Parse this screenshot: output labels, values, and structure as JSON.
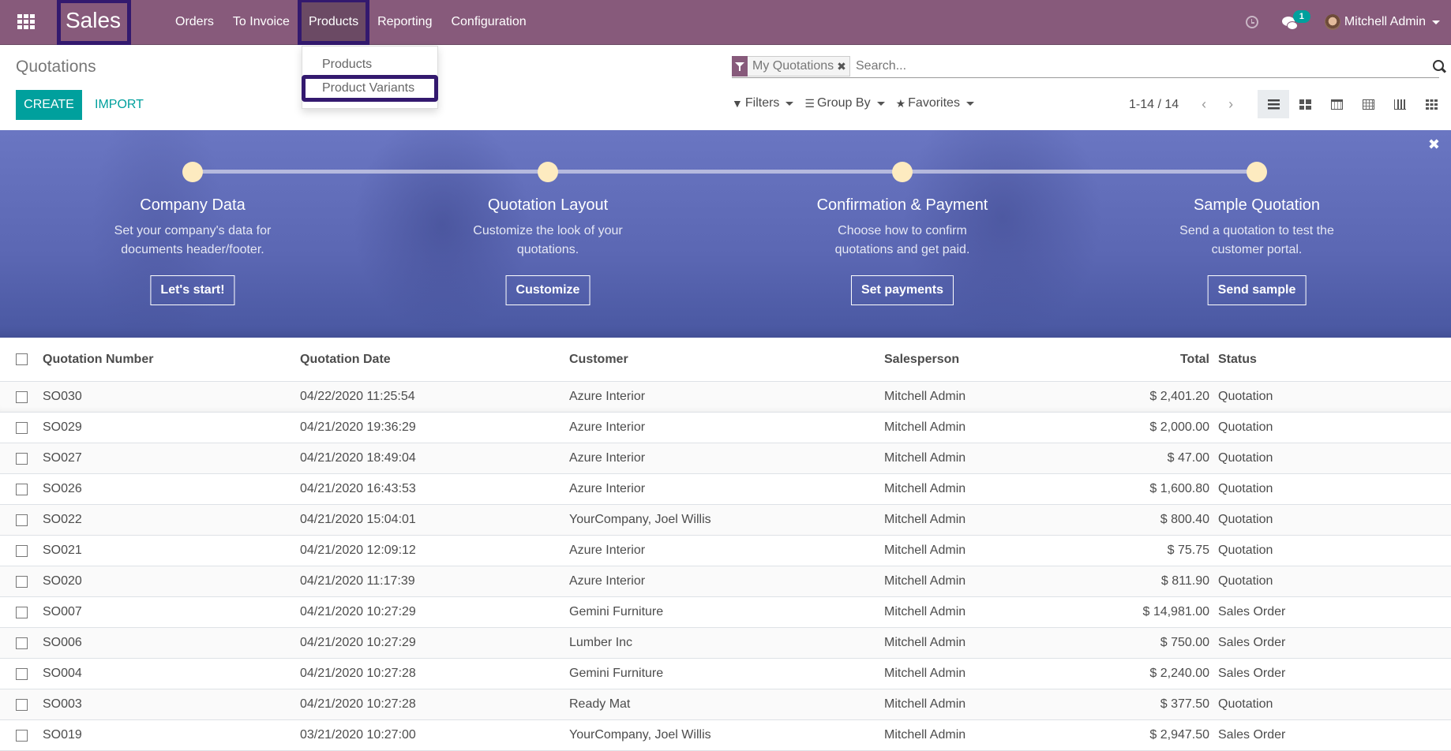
{
  "navbar": {
    "apps_icon": "grid-icon",
    "brand": "Sales",
    "menu": [
      {
        "label": "Orders"
      },
      {
        "label": "To Invoice"
      },
      {
        "label": "Products",
        "active": true
      },
      {
        "label": "Reporting"
      },
      {
        "label": "Configuration"
      }
    ],
    "activity_icon": "clock-icon",
    "messages_icon": "chat-icon",
    "messages_count": "1",
    "user_name": "Mitchell Admin"
  },
  "products_dropdown": {
    "items": [
      {
        "label": "Products"
      },
      {
        "label": "Product Variants",
        "highlighted": true
      }
    ]
  },
  "control_panel": {
    "title": "Quotations",
    "create_label": "CREATE",
    "import_label": "IMPORT",
    "search": {
      "facet_label": "My Quotations",
      "facet_close": "✖",
      "placeholder": "Search..."
    },
    "filters_label": "Filters",
    "groupby_label": "Group By",
    "favorites_label": "Favorites",
    "pager": "1-14 / 14",
    "pager_prev": "‹",
    "pager_next": "›",
    "views": [
      "list",
      "kanban",
      "calendar",
      "pivot",
      "graph",
      "activity"
    ],
    "active_view": "list"
  },
  "colors": {
    "brand": "#875a7b",
    "accent": "#00a09d",
    "highlight_border": "#33196e",
    "banner": "#5b67b3",
    "step_dot": "#fdebc0"
  },
  "onboarding": {
    "close": "✖",
    "steps": [
      {
        "title": "Company Data",
        "desc": "Set your company's data for documents header/footer.",
        "button": "Let's start!"
      },
      {
        "title": "Quotation Layout",
        "desc": "Customize the look of your quotations.",
        "button": "Customize"
      },
      {
        "title": "Confirmation & Payment",
        "desc": "Choose how to confirm quotations and get paid.",
        "button": "Set payments"
      },
      {
        "title": "Sample Quotation",
        "desc": "Send a quotation to test the customer portal.",
        "button": "Send sample"
      }
    ]
  },
  "table": {
    "columns": [
      "Quotation Number",
      "Quotation Date",
      "Customer",
      "Salesperson",
      "Total",
      "Status"
    ],
    "rows": [
      {
        "number": "SO030",
        "date": "04/22/2020 11:25:54",
        "customer": "Azure Interior",
        "salesperson": "Mitchell Admin",
        "total": "$ 2,401.20",
        "status": "Quotation"
      },
      {
        "number": "SO029",
        "date": "04/21/2020 19:36:29",
        "customer": "Azure Interior",
        "salesperson": "Mitchell Admin",
        "total": "$ 2,000.00",
        "status": "Quotation"
      },
      {
        "number": "SO027",
        "date": "04/21/2020 18:49:04",
        "customer": "Azure Interior",
        "salesperson": "Mitchell Admin",
        "total": "$ 47.00",
        "status": "Quotation"
      },
      {
        "number": "SO026",
        "date": "04/21/2020 16:43:53",
        "customer": "Azure Interior",
        "salesperson": "Mitchell Admin",
        "total": "$ 1,600.80",
        "status": "Quotation"
      },
      {
        "number": "SO022",
        "date": "04/21/2020 15:04:01",
        "customer": "YourCompany, Joel Willis",
        "salesperson": "Mitchell Admin",
        "total": "$ 800.40",
        "status": "Quotation"
      },
      {
        "number": "SO021",
        "date": "04/21/2020 12:09:12",
        "customer": "Azure Interior",
        "salesperson": "Mitchell Admin",
        "total": "$ 75.75",
        "status": "Quotation"
      },
      {
        "number": "SO020",
        "date": "04/21/2020 11:17:39",
        "customer": "Azure Interior",
        "salesperson": "Mitchell Admin",
        "total": "$ 811.90",
        "status": "Quotation"
      },
      {
        "number": "SO007",
        "date": "04/21/2020 10:27:29",
        "customer": "Gemini Furniture",
        "salesperson": "Mitchell Admin",
        "total": "$ 14,981.00",
        "status": "Sales Order"
      },
      {
        "number": "SO006",
        "date": "04/21/2020 10:27:29",
        "customer": "Lumber Inc",
        "salesperson": "Mitchell Admin",
        "total": "$ 750.00",
        "status": "Sales Order"
      },
      {
        "number": "SO004",
        "date": "04/21/2020 10:27:28",
        "customer": "Gemini Furniture",
        "salesperson": "Mitchell Admin",
        "total": "$ 2,240.00",
        "status": "Sales Order"
      },
      {
        "number": "SO003",
        "date": "04/21/2020 10:27:28",
        "customer": "Ready Mat",
        "salesperson": "Mitchell Admin",
        "total": "$ 377.50",
        "status": "Quotation"
      },
      {
        "number": "SO019",
        "date": "03/21/2020 10:27:00",
        "customer": "YourCompany, Joel Willis",
        "salesperson": "Mitchell Admin",
        "total": "$ 2,947.50",
        "status": "Sales Order"
      }
    ]
  }
}
